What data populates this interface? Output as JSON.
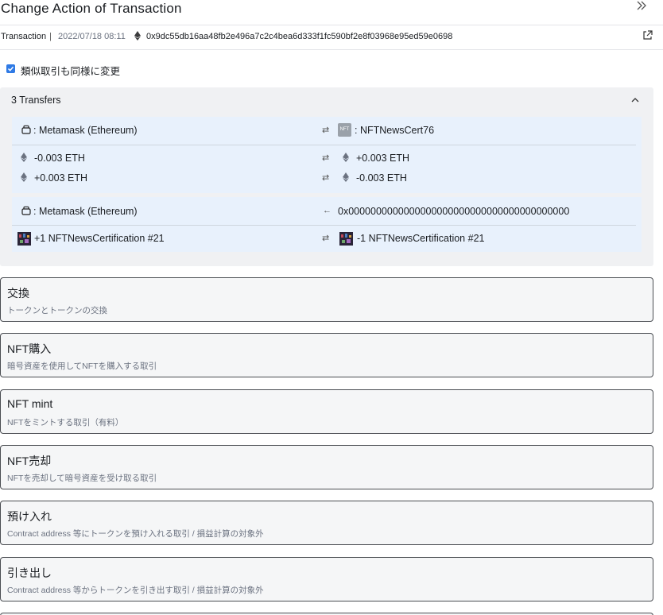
{
  "header": {
    "title": "Change Action of Transaction",
    "collapse_icon": "double-chevron-right-icon"
  },
  "tx": {
    "label": "Transaction",
    "separator": "|",
    "date": "2022/07/18 08:11",
    "hash": "0x9dc55db16aa48fb2e496a7c2c4bea6d333f1fc590bf2e8f03968e95ed59e0698"
  },
  "checkbox": {
    "label": "類似取引も同様に変更",
    "checked": true
  },
  "transfers": {
    "title": "3 Transfers",
    "group1": {
      "from": ": Metamask (Ethereum)",
      "to_badge": "NFT",
      "to": ": NFTNewsCert76",
      "lines": [
        {
          "left": "-0.003 ETH",
          "right": "+0.003 ETH"
        },
        {
          "left": "+0.003 ETH",
          "right": "-0.003 ETH"
        }
      ]
    },
    "group2": {
      "from": ": Metamask (Ethereum)",
      "to": "0x0000000000000000000000000000000000000000",
      "left": "+1 NFTNewsCertification #21",
      "right": "-1 NFTNewsCertification #21"
    }
  },
  "actions": [
    {
      "title": "交換",
      "desc": "トークンとトークンの交換"
    },
    {
      "title": "NFT購入",
      "desc": "暗号資産を使用してNFTを購入する取引"
    },
    {
      "title": "NFT mint",
      "desc": "NFTをミントする取引（有料）"
    },
    {
      "title": "NFT売却",
      "desc": "NFTを売却して暗号資産を受け取る取引"
    },
    {
      "title": "預け入れ",
      "desc": "Contract address 等にトークンを預け入れる取引 / 損益計算の対象外"
    },
    {
      "title": "引き出し",
      "desc": "Contract address 等からトークンを引き出す取引 / 損益計算の対象外"
    }
  ]
}
